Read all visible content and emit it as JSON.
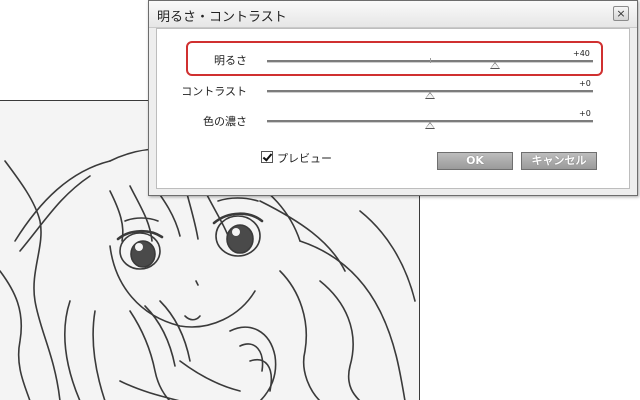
{
  "dialog": {
    "title": "明るさ・コントラスト",
    "close_symbol": "×",
    "sliders": [
      {
        "label": "明るさ",
        "value_text": "+40",
        "position": 0.7,
        "highlighted": true
      },
      {
        "label": "コントラスト",
        "value_text": "+0",
        "position": 0.5,
        "highlighted": false
      },
      {
        "label": "色の濃さ",
        "value_text": "+0",
        "position": 0.5,
        "highlighted": false
      }
    ],
    "preview": {
      "label": "プレビュー",
      "checked": true
    },
    "ok_label": "OK",
    "cancel_label": "キャンセル"
  },
  "colors": {
    "highlight": "#d03030",
    "button": "#a8a8a8"
  },
  "icons": {
    "close": "close-icon",
    "thumb": "triangle-thumb-icon",
    "check": "checkmark-icon"
  }
}
